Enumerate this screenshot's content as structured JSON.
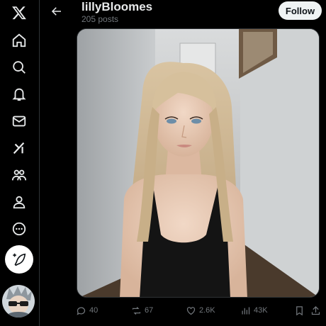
{
  "sidebar": {
    "items": [
      {
        "name": "x-logo-icon"
      },
      {
        "name": "home-icon"
      },
      {
        "name": "search-icon"
      },
      {
        "name": "notifications-icon"
      },
      {
        "name": "messages-icon"
      },
      {
        "name": "grok-icon"
      },
      {
        "name": "communities-icon"
      },
      {
        "name": "profile-icon"
      },
      {
        "name": "more-icon"
      }
    ],
    "compose_icon": "feather-plus-icon"
  },
  "header": {
    "title": "lillyBloomes",
    "post_count": "205 posts",
    "follow_label": "Follow"
  },
  "media": {
    "description_icon": "photo"
  },
  "actions": {
    "replies": "40",
    "reposts": "67",
    "likes": "2.6K",
    "views": "43K"
  },
  "colors": {
    "background": "#000000",
    "text": "#e7e9ea",
    "muted": "#71767b",
    "border": "#2f3336"
  }
}
